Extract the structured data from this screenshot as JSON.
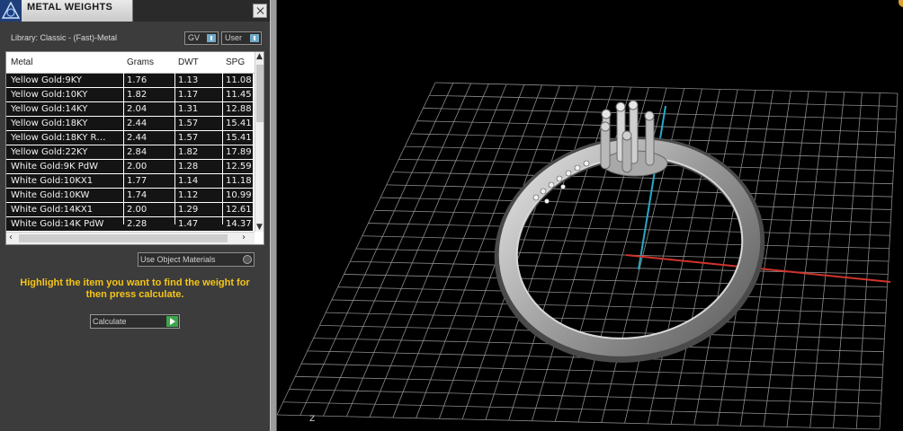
{
  "panel": {
    "title": "METAL WEIGHTS",
    "library_label": "Library: Classic - (Fast)-Metal",
    "gv_label": "GV",
    "user_label": "User",
    "use_object_materials": "Use Object Materials",
    "hint": "Highlight the item you want to find the weight for then press calculate.",
    "calculate_label": "Calculate"
  },
  "table": {
    "headers": [
      "Metal",
      "Grams",
      "DWT",
      "SPG"
    ],
    "rows": [
      [
        "Yellow Gold:9KY",
        "1.76",
        "1.13",
        "11.08"
      ],
      [
        "Yellow Gold:10KY",
        "1.82",
        "1.17",
        "11.45"
      ],
      [
        "Yellow Gold:14KY",
        "2.04",
        "1.31",
        "12.88"
      ],
      [
        "Yellow Gold:18KY",
        "2.44",
        "1.57",
        "15.41"
      ],
      [
        "Yellow Gold:18KY R…",
        "2.44",
        "1.57",
        "15.41"
      ],
      [
        "Yellow Gold:22KY",
        "2.84",
        "1.82",
        "17.89"
      ],
      [
        "White Gold:9K PdW",
        "2.00",
        "1.28",
        "12.59"
      ],
      [
        "White Gold:10KX1",
        "1.77",
        "1.14",
        "11.18"
      ],
      [
        "White Gold:10KW",
        "1.74",
        "1.12",
        "10.99"
      ],
      [
        "White Gold:14KX1",
        "2.00",
        "1.29",
        "12.61"
      ],
      [
        "White Gold:14K PdW",
        "2.28",
        "1.47",
        "14.37"
      ]
    ]
  },
  "viewport": {
    "axis_label": "Z",
    "colors": {
      "grid": "#8a8a8a",
      "axis_x": "#d0342c",
      "axis_y": "#2aa8c8",
      "ring": "#bdbdbd",
      "hint": "#f5c518"
    }
  }
}
